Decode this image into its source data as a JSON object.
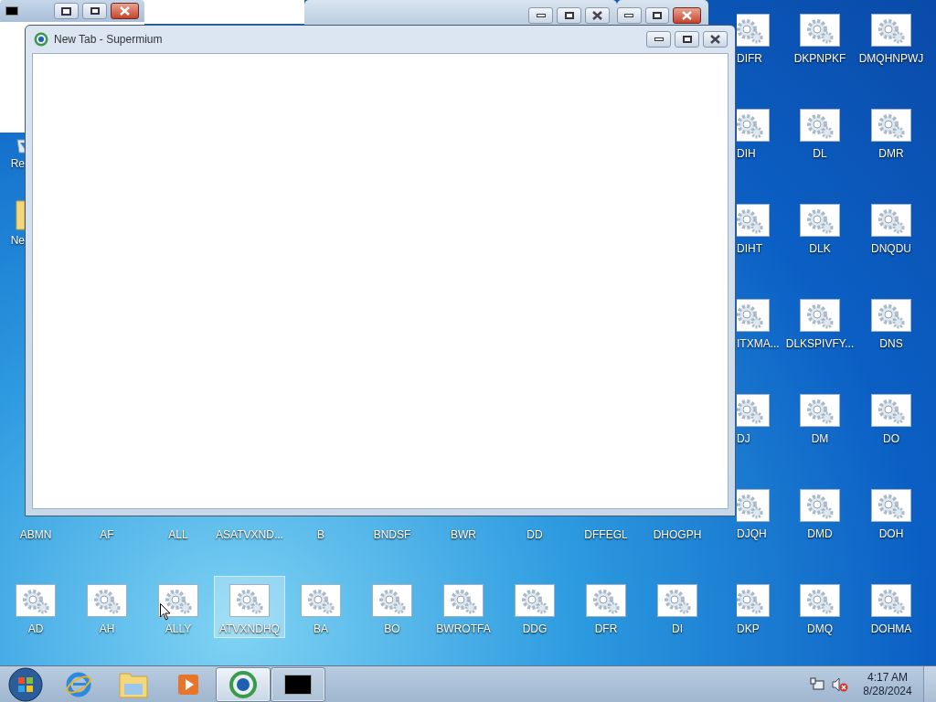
{
  "background_windows": [
    {
      "kind": "console",
      "close_hot": true
    },
    {
      "kind": "blank"
    },
    {
      "kind": "plain",
      "close_hot": false
    },
    {
      "kind": "plain",
      "close_hot": true
    }
  ],
  "desktop": {
    "left_column": [
      {
        "kind": "recycle-bin",
        "label": "Re",
        "selected": false
      },
      {
        "kind": "folder",
        "label": "Ne",
        "selected": false
      }
    ],
    "bottom_rows": [
      {
        "icons": [
          {
            "label": "ABMN",
            "selected": false
          },
          {
            "label": "AF",
            "selected": false
          },
          {
            "label": "ALL",
            "selected": false
          },
          {
            "label": "ASATVXND...",
            "selected": false
          },
          {
            "label": "B",
            "selected": false
          },
          {
            "label": "BNDSF",
            "selected": false
          },
          {
            "label": "BWR",
            "selected": false
          },
          {
            "label": "DD",
            "selected": false
          },
          {
            "label": "DFFEGL",
            "selected": false
          },
          {
            "label": "DHOGPH",
            "selected": false
          }
        ]
      },
      {
        "icons": [
          {
            "kind": "app",
            "label": "AD",
            "selected": false
          },
          {
            "kind": "app",
            "label": "AH",
            "selected": false
          },
          {
            "kind": "app",
            "label": "ALLY",
            "selected": false
          },
          {
            "kind": "app",
            "label": "ATVXNDHQ",
            "selected": true
          },
          {
            "kind": "app",
            "label": "BA",
            "selected": false
          },
          {
            "kind": "app",
            "label": "BO",
            "selected": false
          },
          {
            "kind": "app",
            "label": "BWROTFA",
            "selected": false
          },
          {
            "kind": "app",
            "label": "DDG",
            "selected": false
          },
          {
            "kind": "app",
            "label": "DFR",
            "selected": false
          },
          {
            "kind": "app",
            "label": "DI",
            "selected": false
          }
        ]
      }
    ],
    "right_columns": [
      {
        "icons": [
          {
            "kind": "app",
            "label": "DIFR",
            "selected": false
          },
          {
            "kind": "app",
            "label": "DIH",
            "selected": false
          },
          {
            "kind": "app",
            "label": "DIHT",
            "selected": false
          },
          {
            "kind": "app",
            "label": "ITXMA...",
            "selected": false
          },
          {
            "kind": "app",
            "label": "DJ",
            "selected": false
          },
          {
            "kind": "app",
            "label": "DJQH",
            "selected": false
          },
          {
            "kind": "app",
            "label": "DKP",
            "selected": false
          }
        ]
      },
      {
        "icons": [
          {
            "kind": "app",
            "label": "DKPNPKF",
            "selected": false
          },
          {
            "kind": "app",
            "label": "DL",
            "selected": false
          },
          {
            "kind": "app",
            "label": "DLK",
            "selected": false
          },
          {
            "kind": "app",
            "label": "DLKSPIVFY...",
            "selected": false
          },
          {
            "kind": "app",
            "label": "DM",
            "selected": false
          },
          {
            "kind": "app",
            "label": "DMD",
            "selected": false
          },
          {
            "kind": "app",
            "label": "DMQ",
            "selected": false
          }
        ]
      },
      {
        "icons": [
          {
            "kind": "app",
            "label": "DMQHNPWJ",
            "selected": false
          },
          {
            "kind": "app",
            "label": "DMR",
            "selected": false
          },
          {
            "kind": "app",
            "label": "DNQDU",
            "selected": false
          },
          {
            "kind": "app",
            "label": "DNS",
            "selected": false
          },
          {
            "kind": "app",
            "label": "DO",
            "selected": false
          },
          {
            "kind": "app",
            "label": "DOH",
            "selected": false
          },
          {
            "kind": "app",
            "label": "DOHMA",
            "selected": false
          }
        ]
      }
    ]
  },
  "window": {
    "title": "New Tab - Supermium"
  },
  "taskbar": {
    "items": [
      {
        "kind": "start",
        "selected": false,
        "running": false
      },
      {
        "kind": "browser-e",
        "selected": false,
        "running": false
      },
      {
        "kind": "folder",
        "selected": false,
        "running": false
      },
      {
        "kind": "media",
        "selected": false,
        "running": false
      },
      {
        "kind": "supermium",
        "selected": true,
        "running": true
      },
      {
        "kind": "console",
        "selected": false,
        "running": true
      }
    ],
    "tray": {
      "volume_muted": true,
      "time": "4:17 AM",
      "date": "8/28/2024"
    }
  }
}
